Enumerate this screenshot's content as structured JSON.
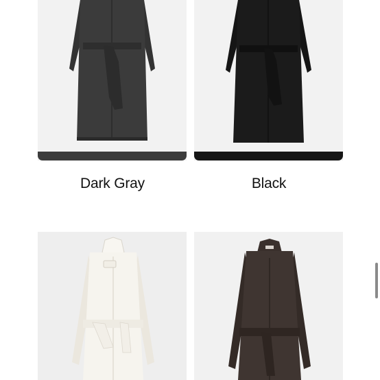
{
  "products": [
    {
      "color_name": "Dark Gray",
      "coat_color": "#3a3a3a",
      "bg_color": "#f2f2f2",
      "swatch_color": "#3c3c3c"
    },
    {
      "color_name": "Black",
      "coat_color": "#1b1b1b",
      "bg_color": "#f2f2f2",
      "swatch_color": "#161616"
    },
    {
      "color_name": "",
      "coat_color": "#f4f1ea",
      "bg_color": "#eeeeee"
    },
    {
      "color_name": "",
      "coat_color": "#3e3430",
      "bg_color": "#f1f1f1"
    }
  ],
  "icons": [
    "coat-photo",
    "scrollbar-thumb"
  ]
}
